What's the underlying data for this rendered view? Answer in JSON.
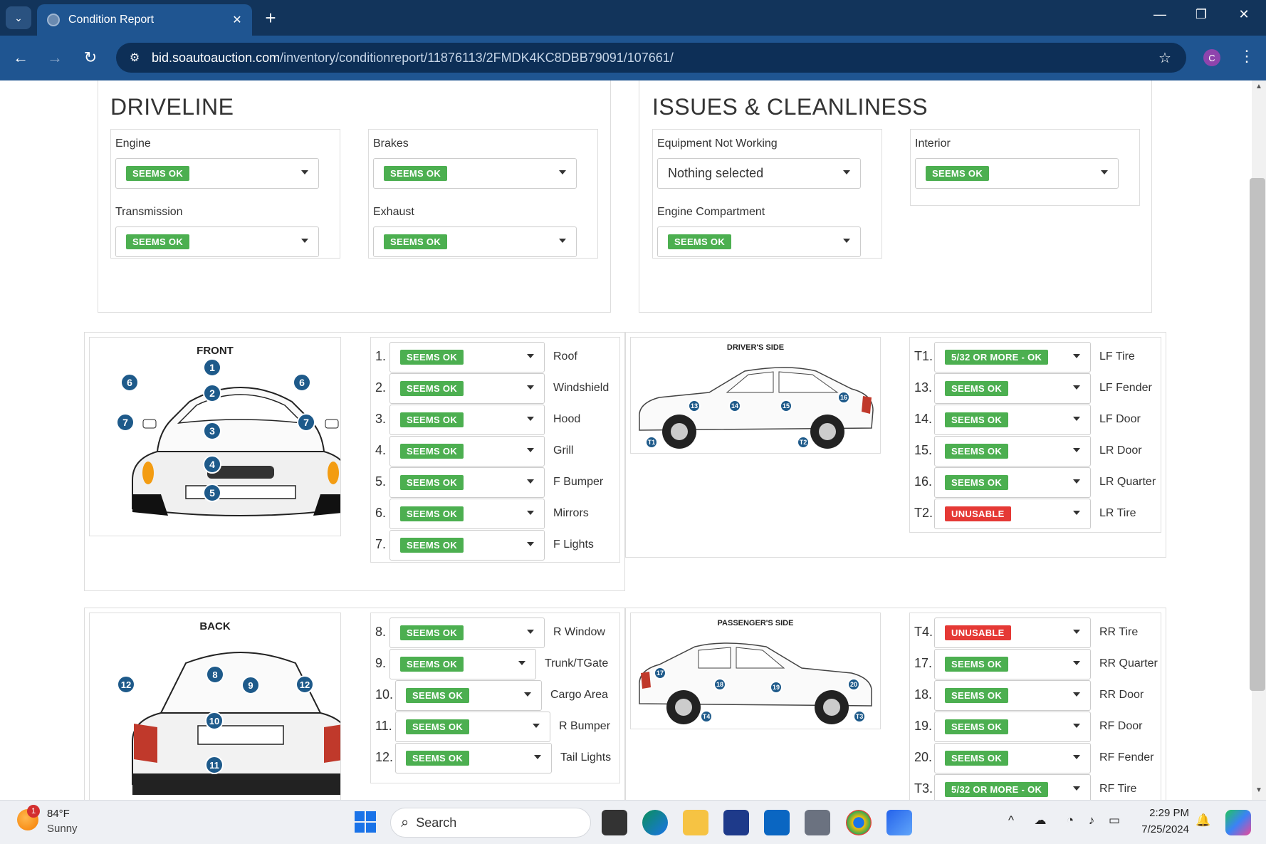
{
  "browser": {
    "tab_title": "Condition Report",
    "tab_close": "✕",
    "new_tab": "+",
    "url_domain": "bid.soautoauction.com",
    "url_path": "/inventory/conditionreport/11876113/2FMDK4KC8DBB79091/107661/",
    "profile_initial": "C"
  },
  "driveline": {
    "title": "DRIVELINE",
    "engine": {
      "label": "Engine",
      "value": "SEEMS OK"
    },
    "brakes": {
      "label": "Brakes",
      "value": "SEEMS OK"
    },
    "transmission": {
      "label": "Transmission",
      "value": "SEEMS OK"
    },
    "exhaust": {
      "label": "Exhaust",
      "value": "SEEMS OK"
    }
  },
  "issues": {
    "title": "ISSUES & CLEANLINESS",
    "equipment": {
      "label": "Equipment Not Working",
      "value": "Nothing selected"
    },
    "interior": {
      "label": "Interior",
      "value": "SEEMS OK"
    },
    "engine_compartment": {
      "label": "Engine Compartment",
      "value": "SEEMS OK"
    }
  },
  "front": {
    "diagram_title": "FRONT",
    "items": [
      {
        "num": "1.",
        "value": "SEEMS OK",
        "label": "Roof"
      },
      {
        "num": "2.",
        "value": "SEEMS OK",
        "label": "Windshield"
      },
      {
        "num": "3.",
        "value": "SEEMS OK",
        "label": "Hood"
      },
      {
        "num": "4.",
        "value": "SEEMS OK",
        "label": "Grill"
      },
      {
        "num": "5.",
        "value": "SEEMS OK",
        "label": "F Bumper"
      },
      {
        "num": "6.",
        "value": "SEEMS OK",
        "label": "Mirrors"
      },
      {
        "num": "7.",
        "value": "SEEMS OK",
        "label": "F Lights"
      }
    ]
  },
  "drivers_side": {
    "diagram_title": "DRIVER'S SIDE",
    "items": [
      {
        "num": "T1.",
        "value": "5/32 OR MORE - OK",
        "label": "LF Tire",
        "status": "ok"
      },
      {
        "num": "13.",
        "value": "SEEMS OK",
        "label": "LF Fender",
        "status": "ok"
      },
      {
        "num": "14.",
        "value": "SEEMS OK",
        "label": "LF Door",
        "status": "ok"
      },
      {
        "num": "15.",
        "value": "SEEMS OK",
        "label": "LR Door",
        "status": "ok"
      },
      {
        "num": "16.",
        "value": "SEEMS OK",
        "label": "LR Quarter",
        "status": "ok"
      },
      {
        "num": "T2.",
        "value": "UNUSABLE",
        "label": "LR Tire",
        "status": "bad"
      }
    ]
  },
  "back": {
    "diagram_title": "BACK",
    "items": [
      {
        "num": "8.",
        "value": "SEEMS OK",
        "label": "R Window"
      },
      {
        "num": "9.",
        "value": "SEEMS OK",
        "label": "Trunk/TGate"
      },
      {
        "num": "10.",
        "value": "SEEMS OK",
        "label": "Cargo Area"
      },
      {
        "num": "11.",
        "value": "SEEMS OK",
        "label": "R Bumper"
      },
      {
        "num": "12.",
        "value": "SEEMS OK",
        "label": "Tail Lights"
      }
    ]
  },
  "passengers_side": {
    "diagram_title": "PASSENGER'S SIDE",
    "items": [
      {
        "num": "T4.",
        "value": "UNUSABLE",
        "label": "RR Tire",
        "status": "bad"
      },
      {
        "num": "17.",
        "value": "SEEMS OK",
        "label": "RR Quarter",
        "status": "ok"
      },
      {
        "num": "18.",
        "value": "SEEMS OK",
        "label": "RR Door",
        "status": "ok"
      },
      {
        "num": "19.",
        "value": "SEEMS OK",
        "label": "RF Door",
        "status": "ok"
      },
      {
        "num": "20.",
        "value": "SEEMS OK",
        "label": "RF Fender",
        "status": "ok"
      },
      {
        "num": "T3.",
        "value": "5/32 OR MORE - OK",
        "label": "RF Tire",
        "status": "ok"
      }
    ]
  },
  "diagram_markers": {
    "front": [
      "1",
      "2",
      "3",
      "4",
      "5",
      "6",
      "6",
      "7",
      "7"
    ],
    "back": [
      "8",
      "9",
      "10",
      "11",
      "12",
      "12"
    ],
    "drivers": [
      "13",
      "14",
      "15",
      "16",
      "T1",
      "T2"
    ],
    "passengers": [
      "17",
      "18",
      "19",
      "20",
      "T4",
      "T3"
    ]
  },
  "taskbar": {
    "weather_badge": "1",
    "temp": "84°F",
    "condition": "Sunny",
    "search_placeholder": "Search",
    "time": "2:29 PM",
    "date": "7/25/2024"
  },
  "colors": {
    "ok": "#4caf50",
    "bad": "#e53935",
    "marker": "#1e5a8a"
  }
}
